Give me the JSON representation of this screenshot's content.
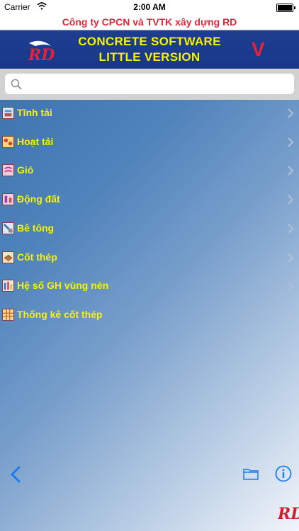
{
  "status_bar": {
    "carrier": "Carrier",
    "time": "2:00 AM"
  },
  "banner": {
    "company": "Công ty CPCN và TVTK xây dựng RD",
    "title_line1": "CONCRETE SOFTWARE",
    "title_line2": "LITTLE VERSION",
    "mark": "V",
    "brand_color": "#1a3a8c",
    "accent_color": "#f6f200"
  },
  "search": {
    "placeholder": "",
    "value": ""
  },
  "menu": {
    "items": [
      {
        "label": "Tĩnh tải",
        "icon": "dead-load-icon"
      },
      {
        "label": "Hoạt tải",
        "icon": "live-load-icon"
      },
      {
        "label": "Gió",
        "icon": "wind-icon"
      },
      {
        "label": "Động đất",
        "icon": "earthquake-icon"
      },
      {
        "label": "Bê tông",
        "icon": "concrete-icon"
      },
      {
        "label": "Cốt thép",
        "icon": "rebar-icon"
      },
      {
        "label": "Hệ số GH vùng nén",
        "icon": "compression-zone-icon"
      },
      {
        "label": "Thống kê cốt thép",
        "icon": "rebar-statistics-icon"
      }
    ]
  },
  "toolbar": {
    "back": "back-chevron-icon",
    "folder": "folder-icon",
    "info": "info-icon"
  }
}
